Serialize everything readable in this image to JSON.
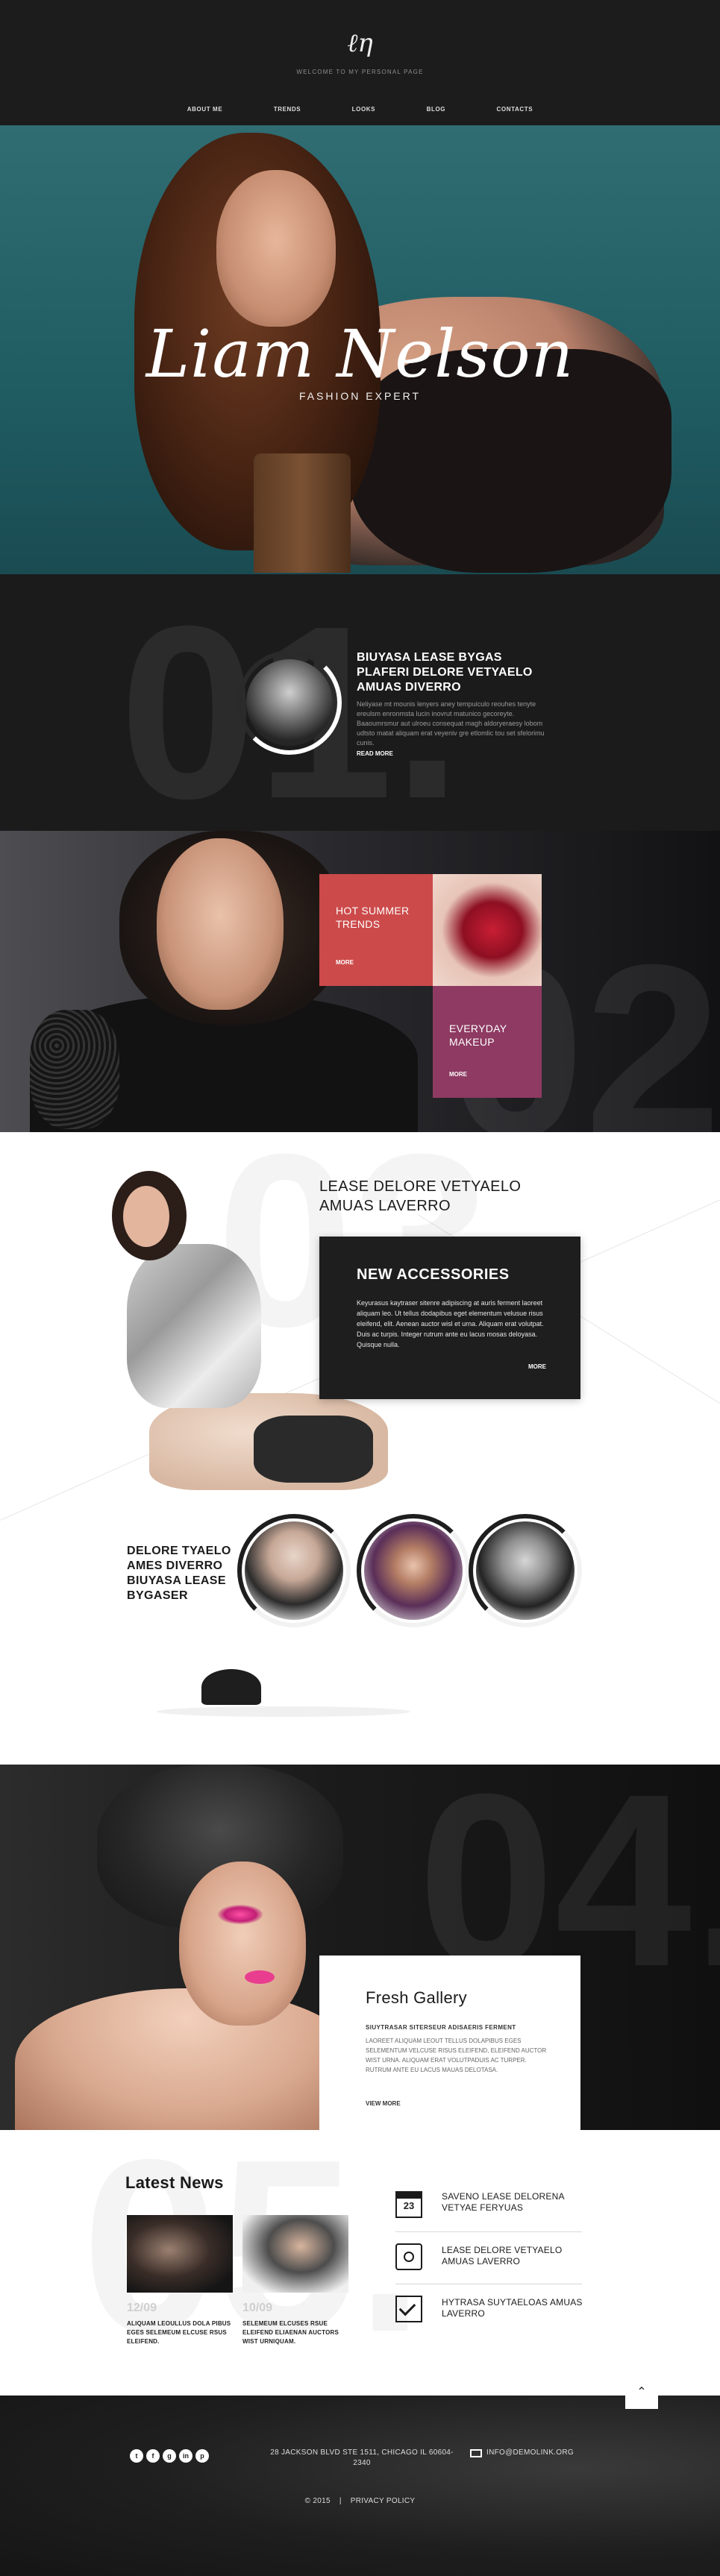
{
  "header": {
    "logo": "ℓη",
    "tagline": "WELCOME TO MY PERSONAL PAGE",
    "nav": [
      "ABOUT ME",
      "TRENDS",
      "LOOKS",
      "BLOG",
      "CONTACTS"
    ]
  },
  "hero": {
    "name": "Liam Nelson",
    "role": "FASHION EXPERT"
  },
  "section1": {
    "number": "01.",
    "title": "BIUYASA LEASE BYGAS PLAFERI DELORE VETYAELO AMUAS DIVERRO",
    "text": "Neliyase mt mounis lenyers aney tempuiculo reouhes tenyte ereulsm enronmsta lucin inovrut matunico gecoreyte. Baaoumrsmur aut ulroeu consequat magh aldoryeraesy lobom udtsto matat aliquam erat veyeniv gre etlomlic tou set sfelorimu cunis.",
    "more": "READ MORE"
  },
  "section2": {
    "number": "02",
    "tile1_label": "HOT SUMMER TRENDS",
    "tile1_more": "MORE",
    "tile2_label": "EVERYDAY MAKEUP",
    "tile2_more": "MORE"
  },
  "section3": {
    "number": "03",
    "heading": "LEASE DELORE VETYAELO AMUAS LAVERRO",
    "card_title": "NEW ACCESSORIES",
    "card_text": "Keyurasus kaytraser sitenre adipiscing at auris ferment laoreet aliquam leo. Ut tellus dodapibus eget elementum velusue risus eleifend, elit. Aenean auctor wisl et urna. Aliquam erat volutpat. Duis ac turpis. Integer rutrum ante eu lacus mosas deloyasa. Quisque nulla.",
    "card_more": "MORE",
    "sub": "DELORE TYAELO AMES DIVERRO BIUYASA LEASE BYGASER"
  },
  "section4": {
    "number": "04.",
    "card_title": "Fresh Gallery",
    "card_sub": "SIUYTRASAR SITERSEUR ADISAERIS FERMENT",
    "card_text": "LAOREET ALIQUAM LEOUT TELLUS DOLAPIBUS EGES SELEMENTUM VELCUSE RISUS ELEIFEND, ELEIFEND AUCTOR WIST URNA. ALIQUAM ERAT VOLUTPADUIS AC TURPER. RUTRUM ANTE EU LACUS MAUAS DELOTASA.",
    "card_more": "VIEW MORE"
  },
  "section5": {
    "number": "05.",
    "title": "Latest News",
    "news": [
      {
        "date": "12/09",
        "text": "ALIQUAM LEOULLUS DOLA PIBUS EGES SELEMEUM ELCUSE RSUS ELEIFEND."
      },
      {
        "date": "10/09",
        "text": "SELEMEUM ELCUSES RSUE ELEIFEND ELIAENAN AUCTORS WIST URNIQUAM."
      }
    ],
    "list": [
      {
        "icon": "calendar-icon",
        "badge": "23",
        "text": "SAVENO LEASE DELORENA VETYAE FERYUAS"
      },
      {
        "icon": "camera-icon",
        "text": "LEASE DELORE VETYAELO AMUAS LAVERRO"
      },
      {
        "icon": "check-icon",
        "text": "HYTRASA SUYTAELOAS AMUAS LAVERRO"
      }
    ]
  },
  "footer": {
    "scroll_top": "⌃",
    "social": [
      "t",
      "f",
      "g",
      "in",
      "p"
    ],
    "address": "28 JACKSON BLVD STE 1511, CHICAGO IL 60604-2340",
    "email": "INFO@DEMOLINK.ORG",
    "copyright": "© 2015",
    "separator": "|",
    "privacy": "PRIVACY POLICY"
  },
  "colors": {
    "accent_red": "#cc4a4a",
    "accent_plum": "#8e3a62",
    "dark": "#1b1b1b"
  }
}
